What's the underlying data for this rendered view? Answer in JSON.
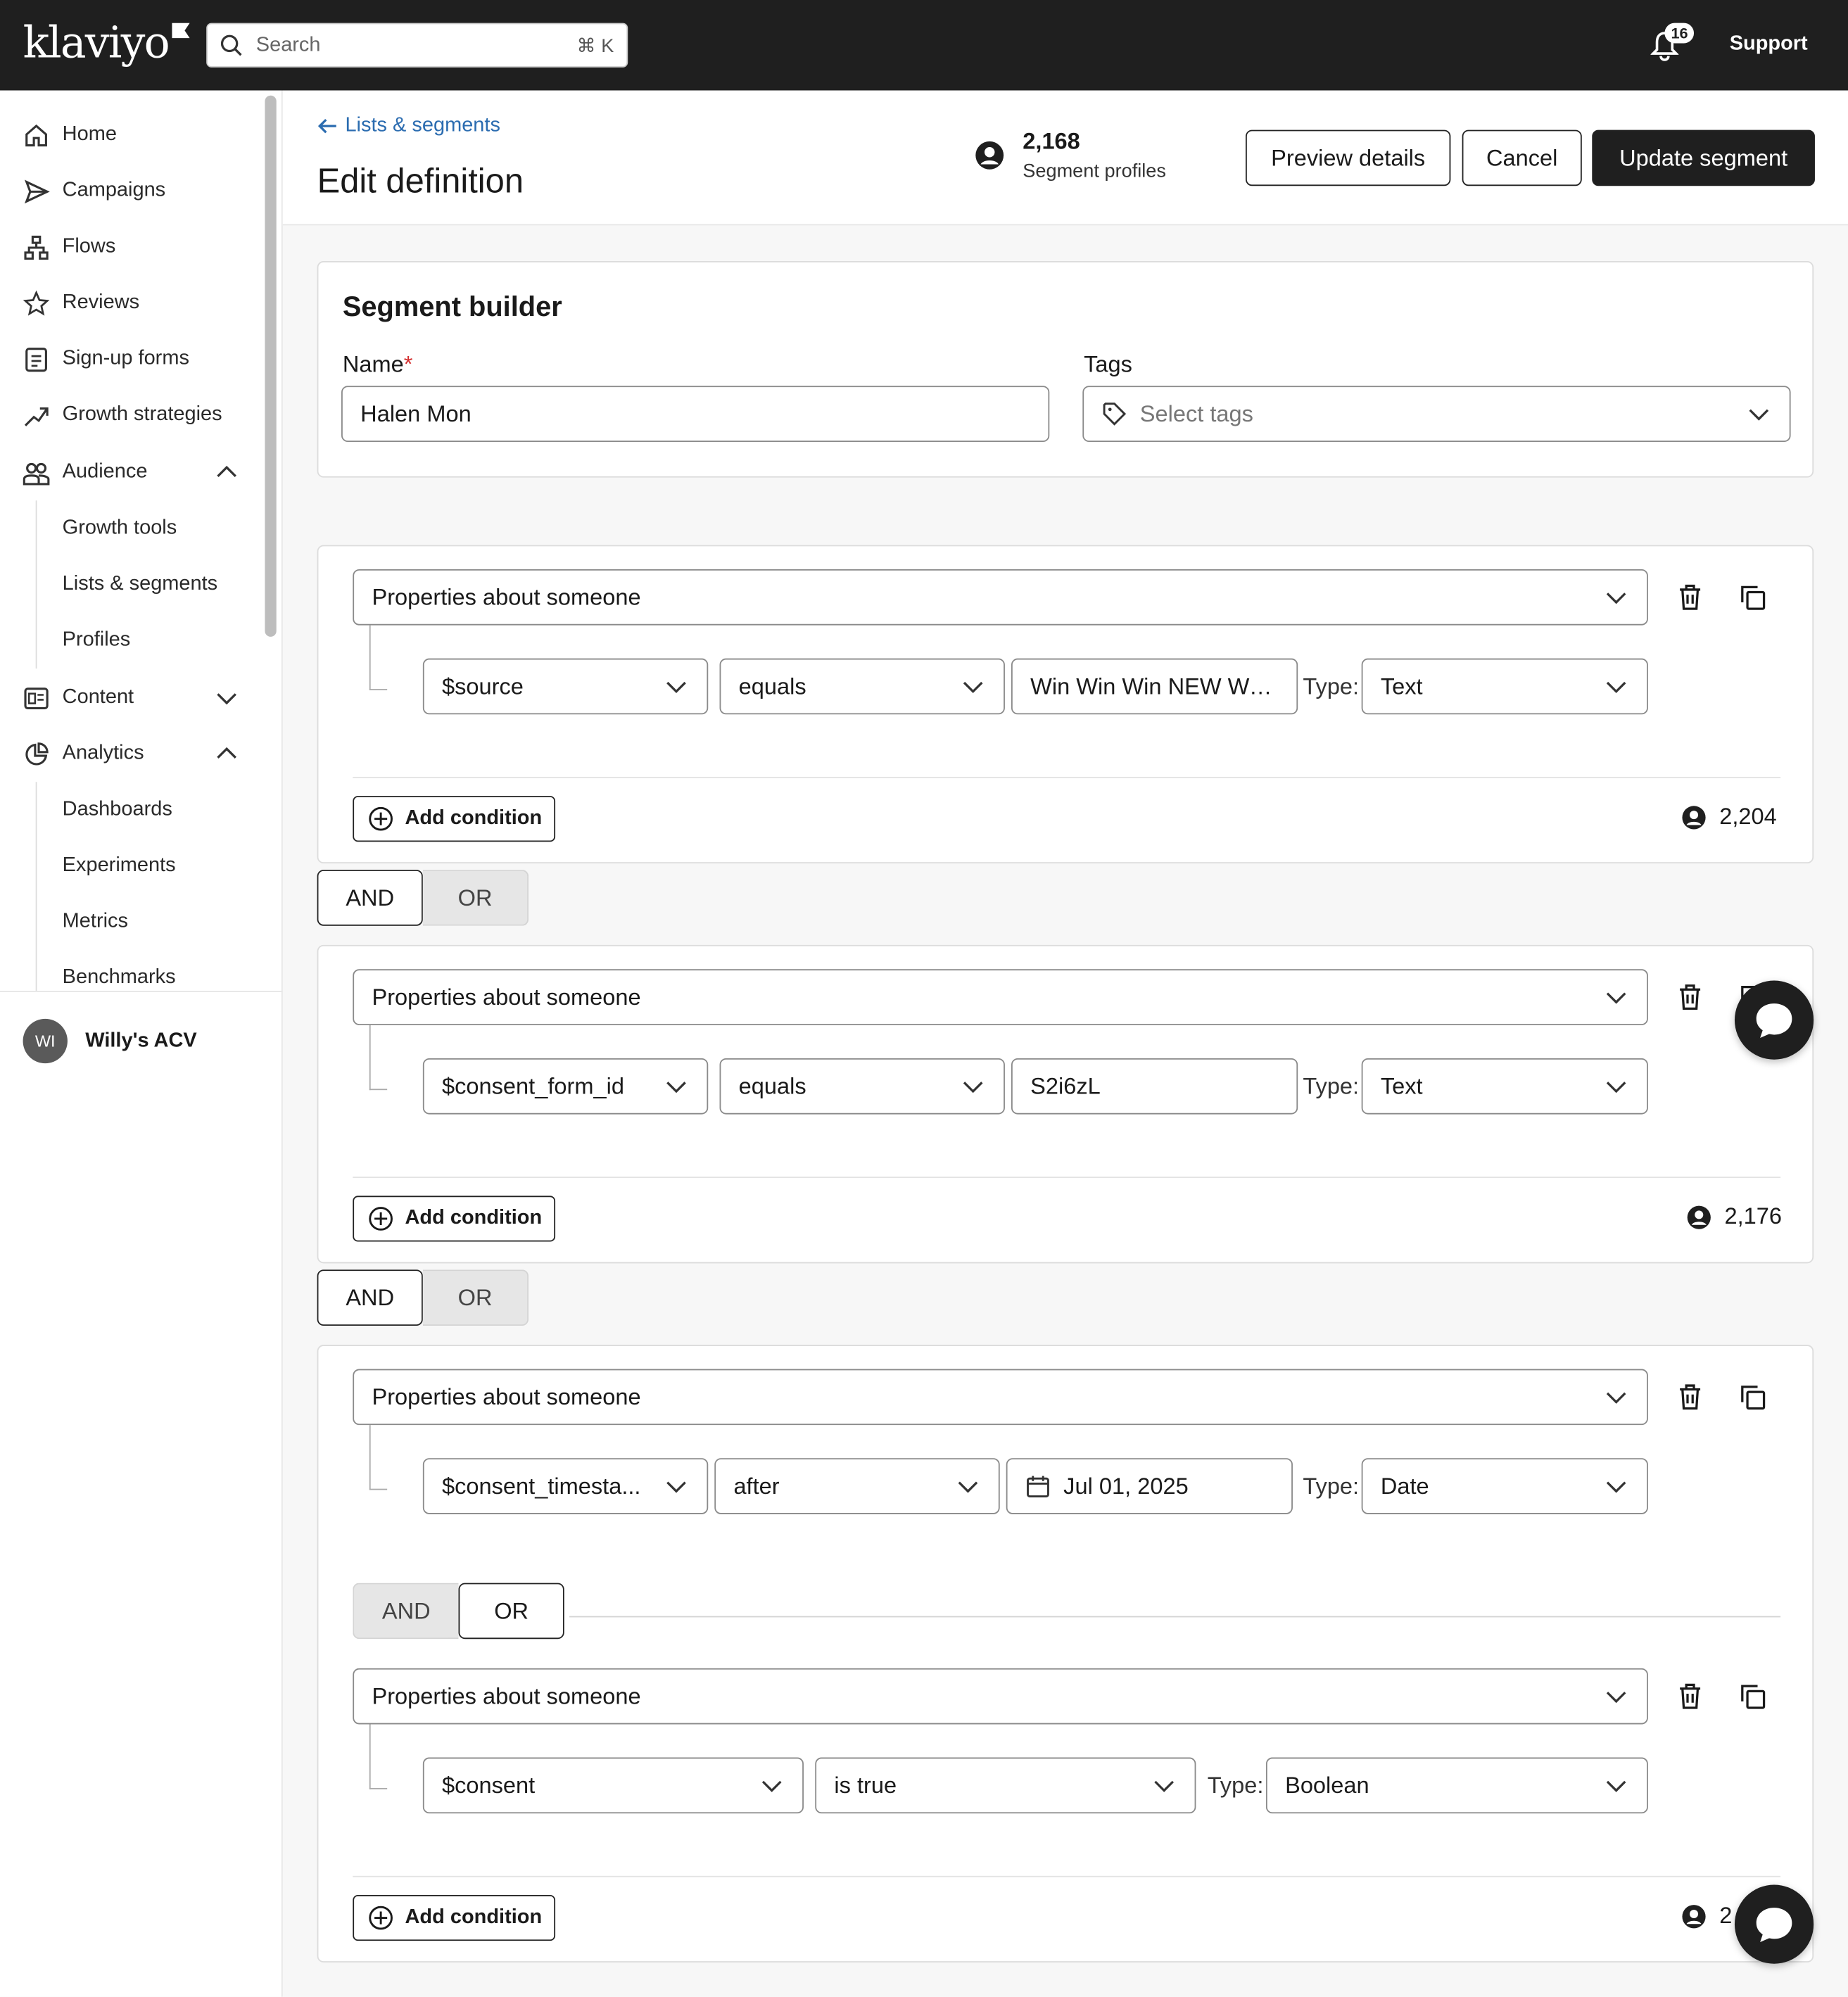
{
  "topbar": {
    "logo": "klaviyo",
    "search_placeholder": "Search",
    "search_shortcut": "⌘ K",
    "notification_count": "16",
    "support_label": "Support"
  },
  "sidebar": {
    "items": [
      {
        "label": "Home",
        "icon": "home-icon"
      },
      {
        "label": "Campaigns",
        "icon": "send-icon"
      },
      {
        "label": "Flows",
        "icon": "flows-icon"
      },
      {
        "label": "Reviews",
        "icon": "star-icon"
      },
      {
        "label": "Sign-up forms",
        "icon": "form-icon"
      },
      {
        "label": "Growth strategies",
        "icon": "trend-icon"
      },
      {
        "label": "Audience",
        "icon": "audience-icon",
        "expanded": true
      },
      {
        "label": "Content",
        "icon": "content-icon",
        "expanded": false
      },
      {
        "label": "Analytics",
        "icon": "analytics-icon",
        "expanded": true
      }
    ],
    "audience_sub": [
      "Growth tools",
      "Lists & segments",
      "Profiles"
    ],
    "analytics_sub": [
      "Dashboards",
      "Experiments",
      "Metrics",
      "Benchmarks"
    ],
    "account": {
      "initials": "WI",
      "name": "Willy's ACV"
    }
  },
  "header": {
    "breadcrumb": "Lists & segments",
    "title": "Edit definition",
    "segment_profiles_count": "2,168",
    "segment_profiles_label": "Segment profiles",
    "preview_button": "Preview details",
    "cancel_button": "Cancel",
    "update_button": "Update segment"
  },
  "builder": {
    "title": "Segment builder",
    "name_label": "Name",
    "name_required": "*",
    "name_value": "Halen Mon",
    "tags_label": "Tags",
    "tags_placeholder": "Select tags"
  },
  "groups": [
    {
      "conditions": [
        {
          "category": "Properties about someone",
          "property": "$source",
          "operator": "equals",
          "value": "Win Win Win NEW Webs",
          "type_label": "Type:",
          "type": "Text"
        }
      ],
      "add_condition": "Add condition",
      "count": "2,204"
    },
    {
      "conditions": [
        {
          "category": "Properties about someone",
          "property": "$consent_form_id",
          "operator": "equals",
          "value": "S2i6zL",
          "type_label": "Type:",
          "type": "Text"
        }
      ],
      "add_condition": "Add condition",
      "count": "2,176"
    },
    {
      "conditions": [
        {
          "category": "Properties about someone",
          "property": "$consent_timesta...",
          "operator": "after",
          "value": "Jul 01, 2025",
          "type_label": "Type:",
          "type": "Date"
        },
        {
          "category": "Properties about someone",
          "property": "$consent",
          "operator": "is true",
          "type_label": "Type:",
          "type": "Boolean"
        }
      ],
      "inner_toggle": {
        "and": "AND",
        "or": "OR",
        "selected": "OR"
      },
      "add_condition": "Add condition",
      "count": "2"
    }
  ],
  "group_toggles": [
    {
      "and": "AND",
      "or": "OR",
      "selected": "AND"
    },
    {
      "and": "AND",
      "or": "OR",
      "selected": "AND"
    }
  ]
}
